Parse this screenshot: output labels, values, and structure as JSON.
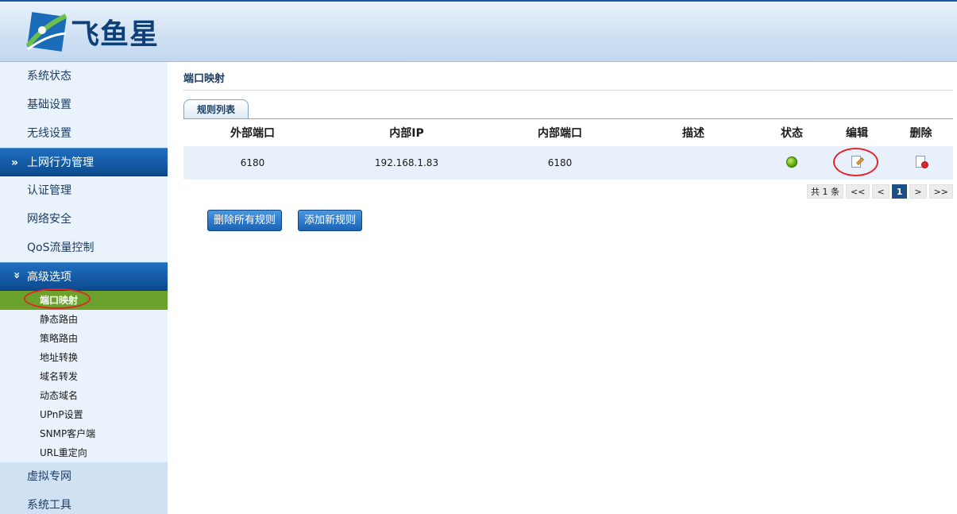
{
  "header": {
    "logo_text": "飞鱼星"
  },
  "sidebar": {
    "top_items": [
      {
        "label": "系统状态"
      },
      {
        "label": "基础设置"
      },
      {
        "label": "无线设置"
      }
    ],
    "section_behavior": {
      "label": "上网行为管理",
      "chev": "»"
    },
    "behavior_items": [
      {
        "label": "认证管理"
      },
      {
        "label": "网络安全"
      },
      {
        "label": "QoS流量控制"
      }
    ],
    "section_advanced": {
      "label": "高级选项",
      "chev": "»"
    },
    "advanced_items": [
      {
        "label": "端口映射"
      },
      {
        "label": "静态路由"
      },
      {
        "label": "策略路由"
      },
      {
        "label": "地址转换"
      },
      {
        "label": "域名转发"
      },
      {
        "label": "动态域名"
      },
      {
        "label": "UPnP设置"
      },
      {
        "label": "SNMP客户端"
      },
      {
        "label": "URL重定向"
      }
    ],
    "bottom_items": [
      {
        "label": "虚拟专网"
      },
      {
        "label": "系统工具"
      }
    ]
  },
  "main": {
    "title": "端口映射",
    "tab_label": "规则列表",
    "columns": [
      "外部端口",
      "内部IP",
      "内部端口",
      "描述",
      "状态",
      "编辑",
      "删除"
    ],
    "rows": [
      {
        "external_port": "6180",
        "internal_ip": "192.168.1.83",
        "internal_port": "6180",
        "description": "",
        "status": "enabled"
      }
    ],
    "pager": {
      "count": "共 1 条",
      "first": "<<",
      "prev": "<",
      "current": "1",
      "next": ">",
      "last": ">>"
    },
    "actions": {
      "delete_all": "删除所有规则",
      "add_new": "添加新规则"
    }
  },
  "colors": {
    "status_enabled": "#58a80a",
    "active_nav": "#6aa22c",
    "section_bg": "#0c4a8e",
    "annotation": "#e0262a"
  }
}
